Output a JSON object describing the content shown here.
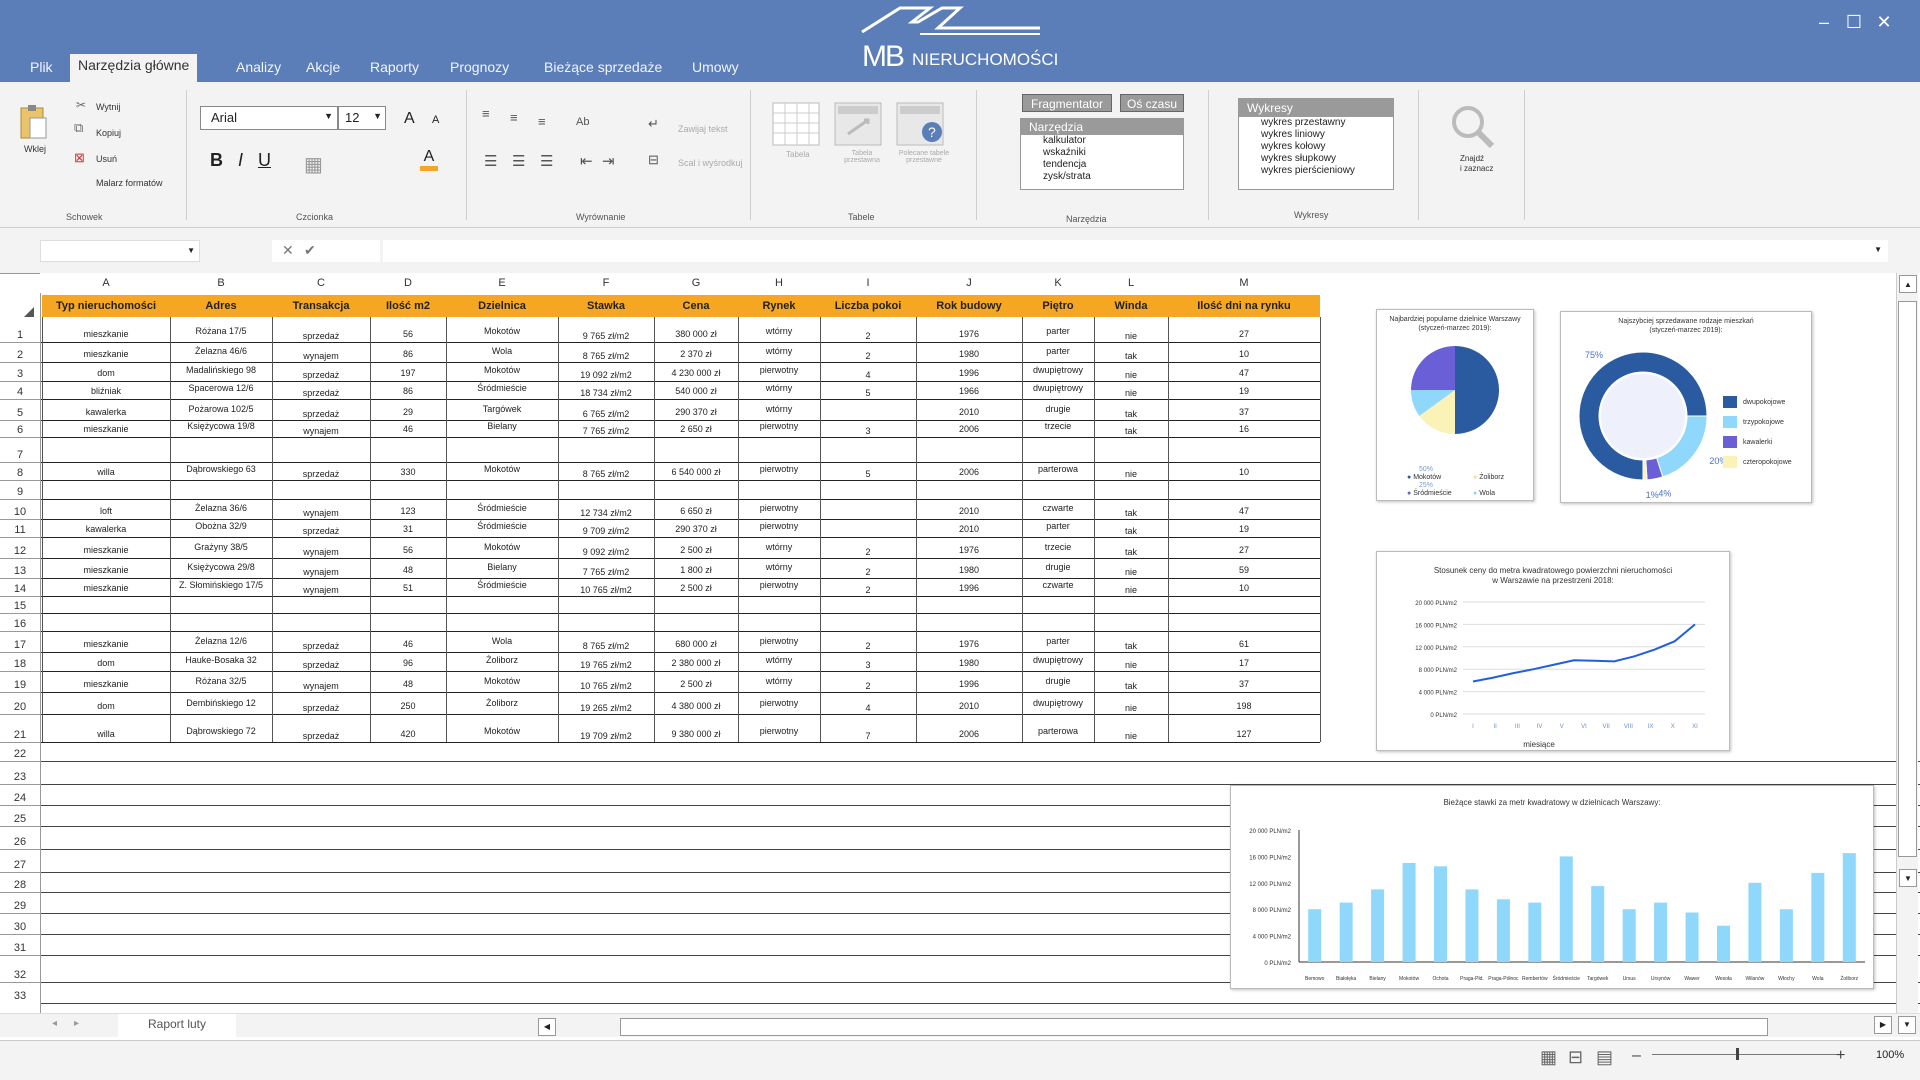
{
  "tabs": [
    "Plik",
    "Narzędzia główne",
    "Analizy",
    "Akcje",
    "Raporty",
    "Prognozy",
    "Bieżące sprzedaże",
    "Umowy"
  ],
  "logo": {
    "mb": "MB",
    "name": "NIERUCHOMOŚCI"
  },
  "clipboard": {
    "paste": "Wklej",
    "cut": "Wytnij",
    "copy": "Kopiuj",
    "delete": "Usuń",
    "painter": "Malarz formatów",
    "group": "Schowek"
  },
  "font": {
    "name": "Arial",
    "size": "12",
    "group": "Czcionka",
    "bold": "B",
    "italic": "I",
    "underline": "U",
    "grow": "A",
    "shrink": "A",
    "color": "A"
  },
  "align": {
    "wrap": "Zawijaj tekst",
    "merge": "Scal i wyśrodkuj",
    "group": "Wyrównanie",
    "orient": "Ab"
  },
  "tables": {
    "t1": "Tabela",
    "t2": "Tabela przestawna",
    "t3": "Polecane tabele przestawne",
    "group": "Tabele"
  },
  "tools": {
    "fragmentator": "Fragmentator",
    "timeline": "Oś czasu",
    "list_title": "Narzędzia",
    "items": [
      "kalkulator",
      "wskaźniki",
      "tendencja",
      "zysk/strata"
    ],
    "group": "Narzędzia"
  },
  "charts_list": {
    "title": "Wykresy",
    "items": [
      "wykres przestawny",
      "wykres liniowy",
      "wykres kołowy",
      "wykres słupkowy",
      "wykres pierścieniowy"
    ],
    "group": "Wykresy"
  },
  "find": {
    "label1": "Znajdź",
    "label2": "i zaznacz"
  },
  "columns": [
    "A",
    "B",
    "C",
    "D",
    "E",
    "F",
    "G",
    "H",
    "I",
    "J",
    "K",
    "L",
    "M"
  ],
  "headers": [
    "Typ nieruchomości",
    "Adres",
    "Transakcja",
    "Ilość m2",
    "Dzielnica",
    "Stawka",
    "Cena",
    "Rynek",
    "Liczba pokoi",
    "Rok budowy",
    "Piętro",
    "Winda",
    "Ilość dni na rynku"
  ],
  "rows": {
    "1": [
      "mieszkanie",
      "Różana 17/5",
      "sprzedaż",
      "56",
      "Mokotów",
      "9 765 zł/m2",
      "380 000 zł",
      "wtórny",
      "2",
      "1976",
      "parter",
      "nie",
      "27"
    ],
    "2": [
      "mieszkanie",
      "Żelazna 46/6",
      "wynajem",
      "86",
      "Wola",
      "8 765 zł/m2",
      "2 370 zł",
      "wtórny",
      "2",
      "1980",
      "parter",
      "tak",
      "10"
    ],
    "3": [
      "dom",
      "Madalińskiego 98",
      "sprzedaż",
      "197",
      "Mokotów",
      "19 092 zł/m2",
      "4 230 000 zł",
      "pierwotny",
      "4",
      "1996",
      "dwupiętrowy",
      "nie",
      "47"
    ],
    "4": [
      "bliźniak",
      "Spacerowa 12/6",
      "sprzedaż",
      "86",
      "Śródmieście",
      "18 734 zł/m2",
      "540 000 zł",
      "wtórny",
      "5",
      "1966",
      "dwupiętrowy",
      "nie",
      "19"
    ],
    "5": [
      "kawalerka",
      "Pożarowa 102/5",
      "sprzedaż",
      "29",
      "Targówek",
      "6 765 zł/m2",
      "290 370 zł",
      "wtórny",
      "",
      "2010",
      "drugie",
      "tak",
      "37"
    ],
    "6": [
      "mieszkanie",
      "Księżycowa 19/8",
      "wynajem",
      "46",
      "Bielany",
      "7 765 zł/m2",
      "2 650 zł",
      "pierwotny",
      "3",
      "2006",
      "trzecie",
      "tak",
      "16"
    ],
    "8": [
      "willa",
      "Dąbrowskiego 63",
      "sprzedaż",
      "330",
      "Mokotów",
      "8 765 zł/m2",
      "6 540 000 zł",
      "pierwotny",
      "5",
      "2006",
      "parterowa",
      "nie",
      "10"
    ],
    "10": [
      "loft",
      "Żelazna 36/6",
      "wynajem",
      "123",
      "Śródmieście",
      "12 734 zł/m2",
      "6 650 zł",
      "pierwotny",
      "",
      "2010",
      "czwarte",
      "tak",
      "47"
    ],
    "11": [
      "kawalerka",
      "Obożna 32/9",
      "sprzedaż",
      "31",
      "Śródmieście",
      "9 709 zł/m2",
      "290 370 zł",
      "pierwotny",
      "",
      "2010",
      "parter",
      "tak",
      "19"
    ],
    "12": [
      "mieszkanie",
      "Grażyny 38/5",
      "wynajem",
      "56",
      "Mokotów",
      "9 092 zł/m2",
      "2 500 zł",
      "wtórny",
      "2",
      "1976",
      "trzecie",
      "tak",
      "27"
    ],
    "13": [
      "mieszkanie",
      "Księżycowa 29/8",
      "wynajem",
      "48",
      "Bielany",
      "7 765 zł/m2",
      "1 800 zł",
      "wtórny",
      "2",
      "1980",
      "drugie",
      "nie",
      "59"
    ],
    "14": [
      "mieszkanie",
      "Z. Słomińskiego 17/5",
      "wynajem",
      "51",
      "Śródmieście",
      "10 765 zł/m2",
      "2 500 zł",
      "pierwotny",
      "2",
      "1996",
      "czwarte",
      "nie",
      "10"
    ],
    "17": [
      "mieszkanie",
      "Żelazna 12/6",
      "sprzedaż",
      "46",
      "Wola",
      "8 765 zł/m2",
      "680 000 zł",
      "pierwotny",
      "2",
      "1976",
      "parter",
      "tak",
      "61"
    ],
    "18": [
      "dom",
      "Hauke-Bosaka 32",
      "sprzedaż",
      "96",
      "Żoliborz",
      "19 765 zł/m2",
      "2 380 000 zł",
      "wtórny",
      "3",
      "1980",
      "dwupiętrowy",
      "nie",
      "17"
    ],
    "19": [
      "mieszkanie",
      "Różana 32/5",
      "wynajem",
      "48",
      "Mokotów",
      "10 765 zł/m2",
      "2 500 zł",
      "wtórny",
      "2",
      "1996",
      "drugie",
      "tak",
      "37"
    ],
    "20": [
      "dom",
      "Dembińskiego 12",
      "sprzedaż",
      "250",
      "Żoliborz",
      "19 265 zł/m2",
      "4 380 000 zł",
      "pierwotny",
      "4",
      "2010",
      "dwupiętrowy",
      "nie",
      "198"
    ],
    "21": [
      "willa",
      "Dąbrowskiego 72",
      "sprzedaż",
      "420",
      "Mokotów",
      "19 709 zł/m2",
      "9 380 000 zł",
      "pierwotny",
      "7",
      "2006",
      "parterowa",
      "nie",
      "127"
    ]
  },
  "sheet_tab": "Raport luty",
  "zoom": "100%",
  "colors": {
    "titlebar": "#5b7db8",
    "header": "#f5a623",
    "dark": "#2a5aa0",
    "light": "#8fd8fb",
    "purple": "#6a5fd6",
    "cream": "#fbf2b8"
  },
  "chart_data": [
    {
      "type": "pie",
      "title": "Najbardziej popularne dzielnice Warszawy",
      "subtitle": "(styczeń-marzec 2019):",
      "labels": [
        "Mokotów",
        "Śródmieście",
        "Żoliborz",
        "Wola"
      ],
      "values": [
        50,
        25,
        15,
        10
      ],
      "printed_values": [
        "50%",
        "25%",
        "",
        ""
      ]
    },
    {
      "type": "pie",
      "title": "Najszybciej sprzedawane rodzaje mieszkań",
      "subtitle": "(styczeń-marzec 2019):",
      "labels": [
        "dwupokojowe",
        "trzypokojowe",
        "kawalerki",
        "czteropokojowe"
      ],
      "values": [
        75,
        20,
        4,
        1
      ],
      "printed_values": [
        "75%",
        "20%",
        "4%",
        "1%"
      ]
    },
    {
      "type": "line",
      "title": "Stosunek ceny do metra kwadratowego powierzchni nieruchomości",
      "subtitle": "w Warszawie na przestrzeni 2018:",
      "xlabel": "miesiące",
      "categories": [
        "I",
        "II",
        "III",
        "IV",
        "V",
        "VI",
        "VII",
        "VIII",
        "IX",
        "X",
        "XI"
      ],
      "values": [
        5800,
        6500,
        7300,
        8000,
        8800,
        9600,
        9500,
        9400,
        10300,
        11500,
        13000,
        16000
      ],
      "ylim": [
        0,
        20000
      ],
      "yticks": [
        "0 PLN/m2",
        "4 000 PLN/m2",
        "8 000 PLN/m2",
        "12 000 PLN/m2",
        "16 000 PLN/m2",
        "20 000 PLN/m2"
      ]
    },
    {
      "type": "bar",
      "title": "Bieżące stawki za metr kwadratowy w dzielnicach Warszawy:",
      "categories": [
        "Bemowo",
        "Białołęka",
        "Bielany",
        "Mokotów",
        "Ochota",
        "Praga-Płd.",
        "Praga-Północ",
        "Rembertów",
        "Śródmieście",
        "Targówek",
        "Ursus",
        "Ursynów",
        "Wawer",
        "Wesoła",
        "Wilanów",
        "Włochy",
        "Wola",
        "Żoliborz"
      ],
      "values": [
        8000,
        9000,
        11000,
        15000,
        14500,
        11000,
        9500,
        9000,
        16000,
        11500,
        8000,
        9000,
        7500,
        5500,
        12000,
        8000,
        13500,
        16500
      ],
      "ylim": [
        0,
        20000
      ],
      "yticks": [
        "0 PLN/m2",
        "4 000 PLN/m2",
        "8 000 PLN/m2",
        "12 000 PLN/m2",
        "16 000 PLN/m2",
        "20 000 PLN/m2"
      ]
    }
  ]
}
